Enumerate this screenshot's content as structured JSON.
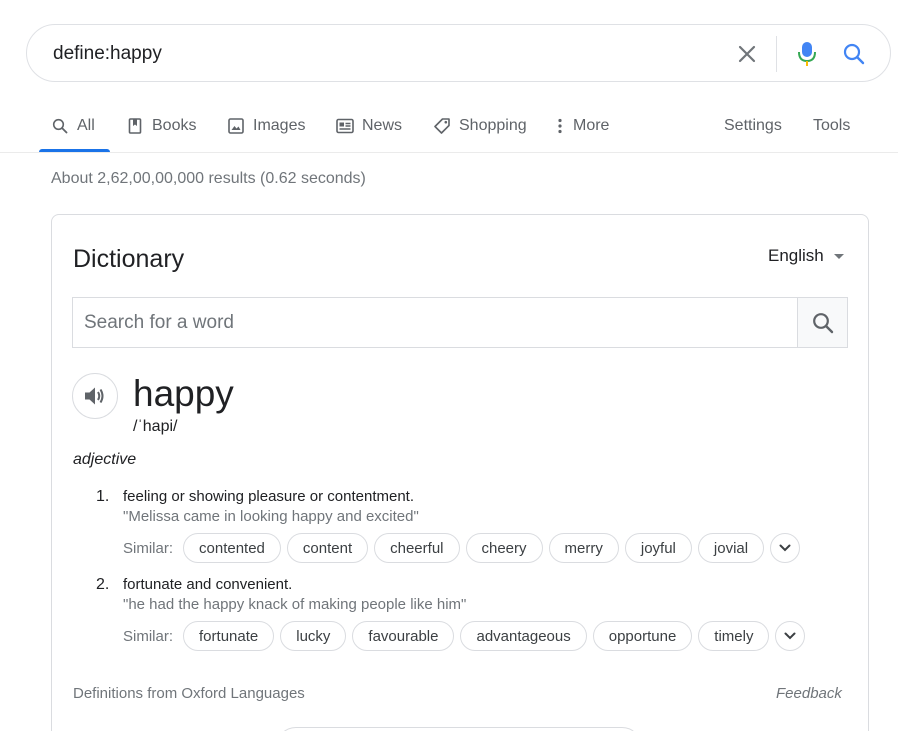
{
  "search": {
    "query": "define:happy"
  },
  "tabs": [
    {
      "label": "All",
      "icon": "search-icon"
    },
    {
      "label": "Books",
      "icon": "book-icon"
    },
    {
      "label": "Images",
      "icon": "image-icon"
    },
    {
      "label": "News",
      "icon": "news-icon"
    },
    {
      "label": "Shopping",
      "icon": "tag-icon"
    },
    {
      "label": "More",
      "icon": "kebab-icon"
    }
  ],
  "tools": {
    "settings": "Settings",
    "tools": "Tools"
  },
  "stats": "About 2,62,00,00,000 results (0.62 seconds)",
  "dictionary": {
    "title": "Dictionary",
    "language": "English",
    "search_placeholder": "Search for a word",
    "word": "happy",
    "phonetic": "/ˈhapi/",
    "part_of_speech": "adjective",
    "similar_label": "Similar:",
    "senses": [
      {
        "num": "1.",
        "definition": "feeling or showing pleasure or contentment.",
        "example": "\"Melissa came in looking happy and excited\"",
        "similar": [
          "contented",
          "content",
          "cheerful",
          "cheery",
          "merry",
          "joyful",
          "jovial"
        ]
      },
      {
        "num": "2.",
        "definition": "fortunate and convenient.",
        "example": "\"he had the happy knack of making people like him\"",
        "similar": [
          "fortunate",
          "lucky",
          "favourable",
          "advantageous",
          "opportune",
          "timely"
        ]
      }
    ],
    "source": "Definitions from Oxford Languages",
    "feedback": "Feedback"
  },
  "colors": {
    "accent": "#1a73e8",
    "muted": "#70757a",
    "border": "#dadce0"
  }
}
